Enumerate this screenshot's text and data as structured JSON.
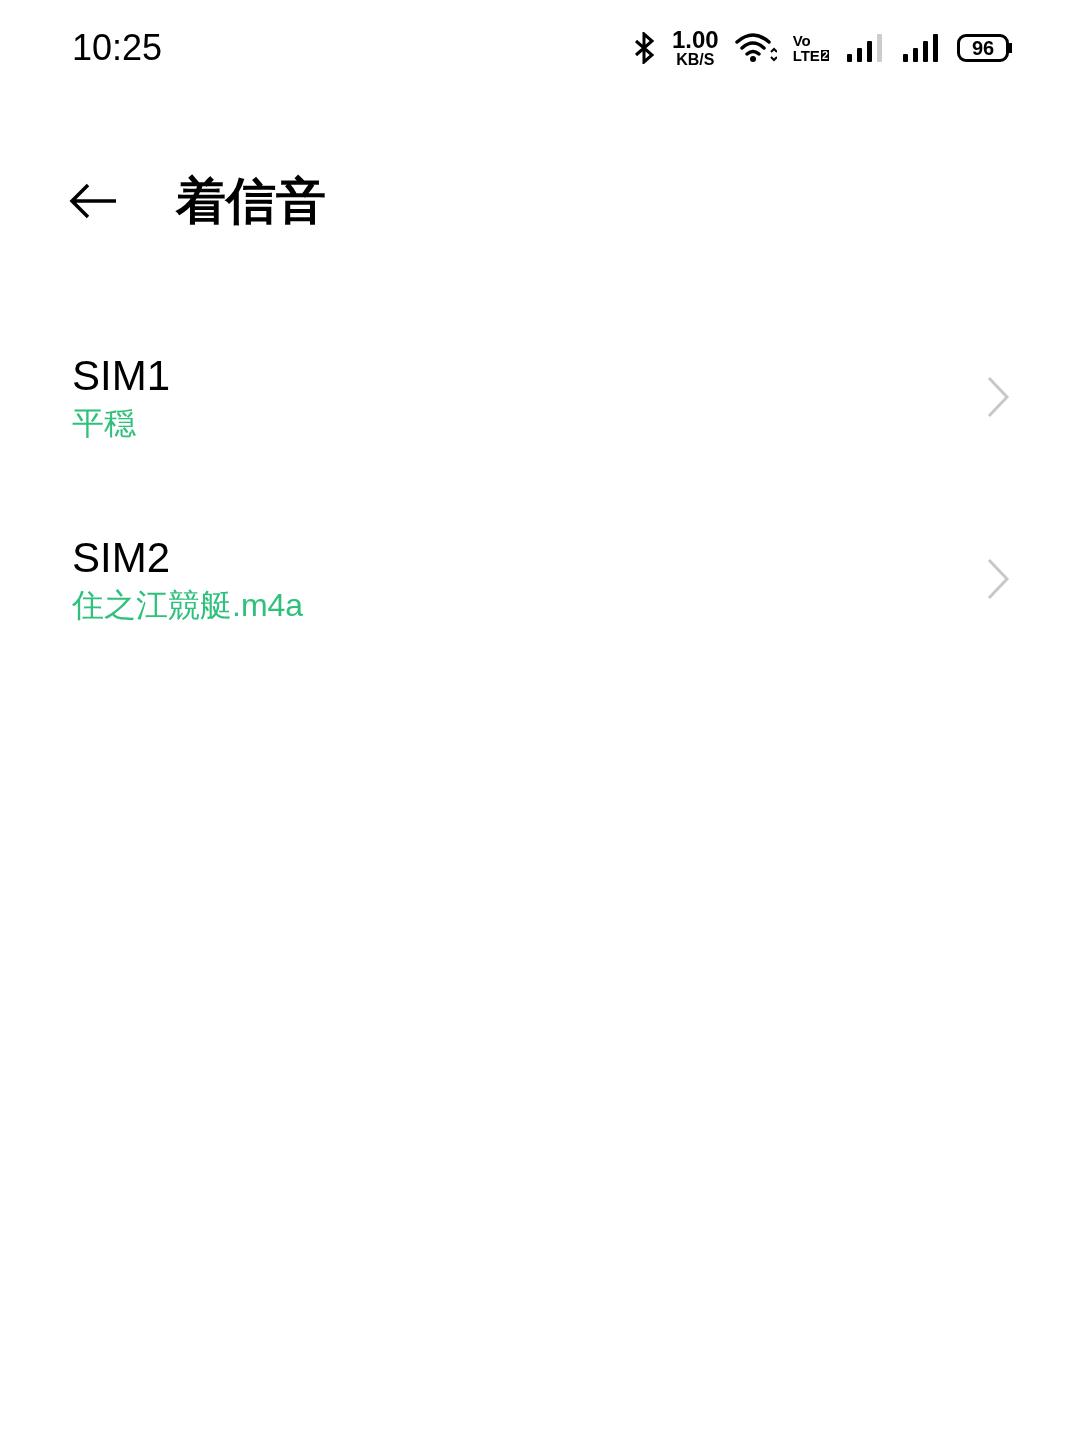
{
  "status_bar": {
    "time": "10:25",
    "speed_value": "1.00",
    "speed_unit": "KB/S",
    "volte_top": "Vo",
    "volte_bottom": "LTE",
    "volte_sim": "2",
    "battery": "96"
  },
  "header": {
    "title": "着信音"
  },
  "items": [
    {
      "title": "SIM1",
      "value": "平穏"
    },
    {
      "title": "SIM2",
      "value": "住之江競艇.m4a"
    }
  ]
}
